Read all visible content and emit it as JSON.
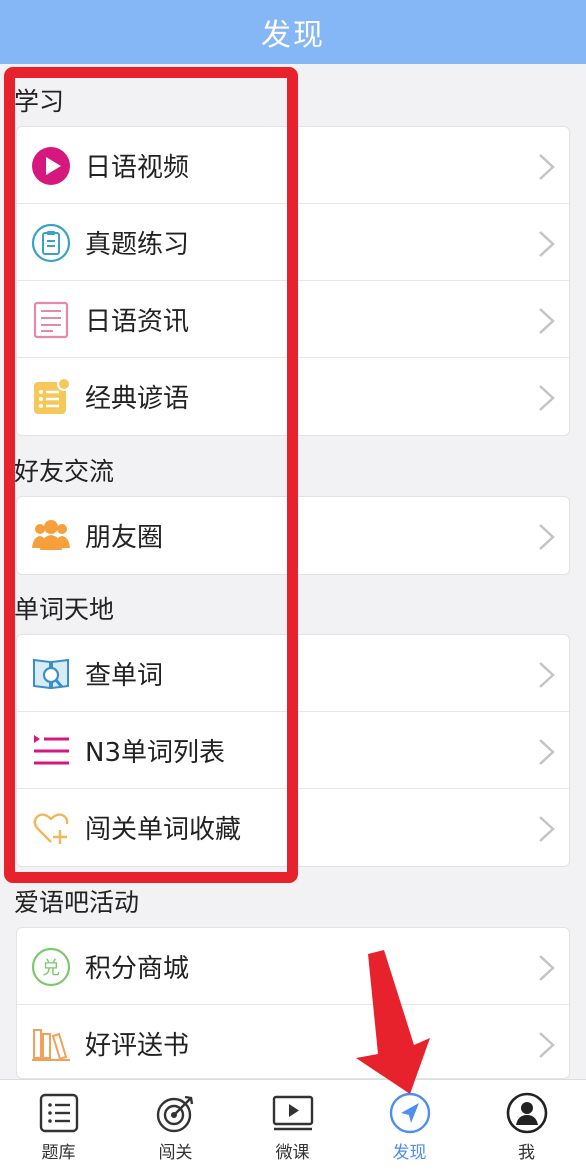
{
  "header": {
    "title": "发现"
  },
  "sections": [
    {
      "title": "学习",
      "items": [
        {
          "label": "日语视频",
          "icon": "play-video-icon"
        },
        {
          "label": "真题练习",
          "icon": "exam-clipboard-icon"
        },
        {
          "label": "日语资讯",
          "icon": "news-document-icon"
        },
        {
          "label": "经典谚语",
          "icon": "notes-list-icon"
        }
      ]
    },
    {
      "title": "好友交流",
      "items": [
        {
          "label": "朋友圈",
          "icon": "friends-group-icon"
        }
      ]
    },
    {
      "title": "单词天地",
      "items": [
        {
          "label": "查单词",
          "icon": "book-search-icon"
        },
        {
          "label": "N3单词列表",
          "icon": "list-icon"
        },
        {
          "label": "闯关单词收藏",
          "icon": "heart-plus-icon"
        }
      ]
    },
    {
      "title": "爱语吧活动",
      "items": [
        {
          "label": "积分商城",
          "icon": "exchange-badge-icon"
        },
        {
          "label": "好评送书",
          "icon": "books-icon"
        }
      ]
    }
  ],
  "tabbar": {
    "tabs": [
      {
        "label": "题库",
        "icon": "question-bank-icon"
      },
      {
        "label": "闯关",
        "icon": "target-icon"
      },
      {
        "label": "微课",
        "icon": "video-lesson-icon"
      },
      {
        "label": "发现",
        "icon": "compass-navigation-icon",
        "active": true
      },
      {
        "label": "我",
        "icon": "user-profile-icon"
      }
    ]
  },
  "colors": {
    "header": "#85b6f5",
    "accent": "#4d8ef0",
    "annotation": "#e8222c"
  }
}
